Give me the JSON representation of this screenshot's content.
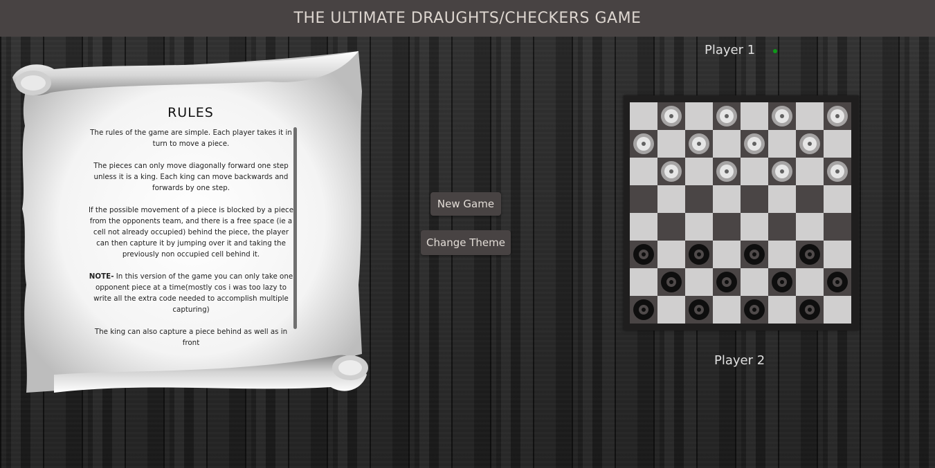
{
  "header": {
    "title": "THE ULTIMATE DRAUGHTS/CHECKERS GAME"
  },
  "rules": {
    "title": "RULES",
    "paragraphs": [
      "The rules of the game are simple. Each player takes it in turn to move a piece.",
      "The pieces can only move diagonally forward one step unless it is a king. Each king can move backwards and forwards by one step.",
      "If the possible movement of a piece is blocked by a piece from the opponents team, and there is a free space (ie a cell not already occupied) behind the piece, the player can then capture it by jumping over it and taking the previously non occupied cell behind it.",
      "In this version of the game you can only take one opponent piece at a time(mostly cos i was too lazy to write all the extra code needed to accomplish multiple capturing)",
      "The king can also capture a piece behind as well as in front"
    ],
    "note_label": "NOTE-"
  },
  "controls": {
    "new_game_label": "New Game",
    "change_theme_label": "Change Theme"
  },
  "players": {
    "player1_label": "Player 1",
    "player2_label": "Player 2",
    "active_player": 1,
    "turn_indicator_color": "#0e9a19"
  },
  "board": {
    "size": 8,
    "light_color": "#d0cfcf",
    "dark_color": "#4a4545",
    "rows": [
      "_T_T_T_T",
      "T_T_T_T_",
      "_T_T_T_T",
      "________",
      "________",
      "B_B_B_B_",
      "_B_B_B_B",
      "B_B_B_B_"
    ]
  }
}
